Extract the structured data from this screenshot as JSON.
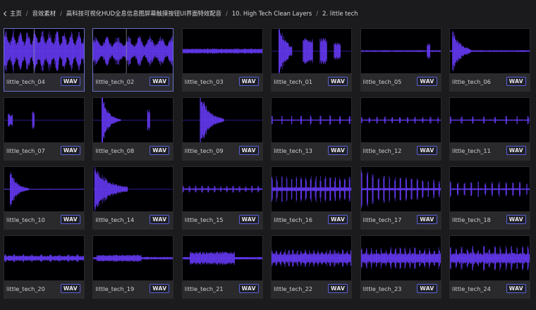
{
  "breadcrumb": {
    "home": "主页",
    "items": [
      "音效素材",
      "高科技可视化HUD全息信息图屏幕触摸按钮UI界面特效配音",
      "10. High Tech Clean Layers",
      "2. little tech"
    ],
    "separator": "/"
  },
  "files": [
    {
      "name": "little_tech_04",
      "format": "WAV",
      "selected": true
    },
    {
      "name": "little_tech_02",
      "format": "WAV",
      "selected": true
    },
    {
      "name": "little_tech_03",
      "format": "WAV"
    },
    {
      "name": "little_tech_01",
      "format": "WAV"
    },
    {
      "name": "little_tech_05",
      "format": "WAV"
    },
    {
      "name": "little_tech_06",
      "format": "WAV"
    },
    {
      "name": "little_tech_07",
      "format": "WAV"
    },
    {
      "name": "little_tech_08",
      "format": "WAV"
    },
    {
      "name": "little_tech_09",
      "format": "WAV"
    },
    {
      "name": "little_tech_13",
      "format": "WAV"
    },
    {
      "name": "little_tech_12",
      "format": "WAV"
    },
    {
      "name": "little_tech_11",
      "format": "WAV"
    },
    {
      "name": "little_tech_10",
      "format": "WAV"
    },
    {
      "name": "little_tech_14",
      "format": "WAV"
    },
    {
      "name": "little_tech_15",
      "format": "WAV"
    },
    {
      "name": "little_tech_16",
      "format": "WAV"
    },
    {
      "name": "little_tech_17",
      "format": "WAV"
    },
    {
      "name": "little_tech_18",
      "format": "WAV"
    },
    {
      "name": "little_tech_20",
      "format": "WAV"
    },
    {
      "name": "little_tech_19",
      "format": "WAV"
    },
    {
      "name": "little_tech_21",
      "format": "WAV"
    },
    {
      "name": "little_tech_22",
      "format": "WAV"
    },
    {
      "name": "little_tech_23",
      "format": "WAV"
    },
    {
      "name": "little_tech_24",
      "format": "WAV"
    }
  ],
  "colors": {
    "waveform": "#4b27d6",
    "waveform_bright": "#6a3cff",
    "badge_border": "#5a62d8",
    "card_bg": "#2a2a2d",
    "selected_border": "#6a70c8"
  }
}
